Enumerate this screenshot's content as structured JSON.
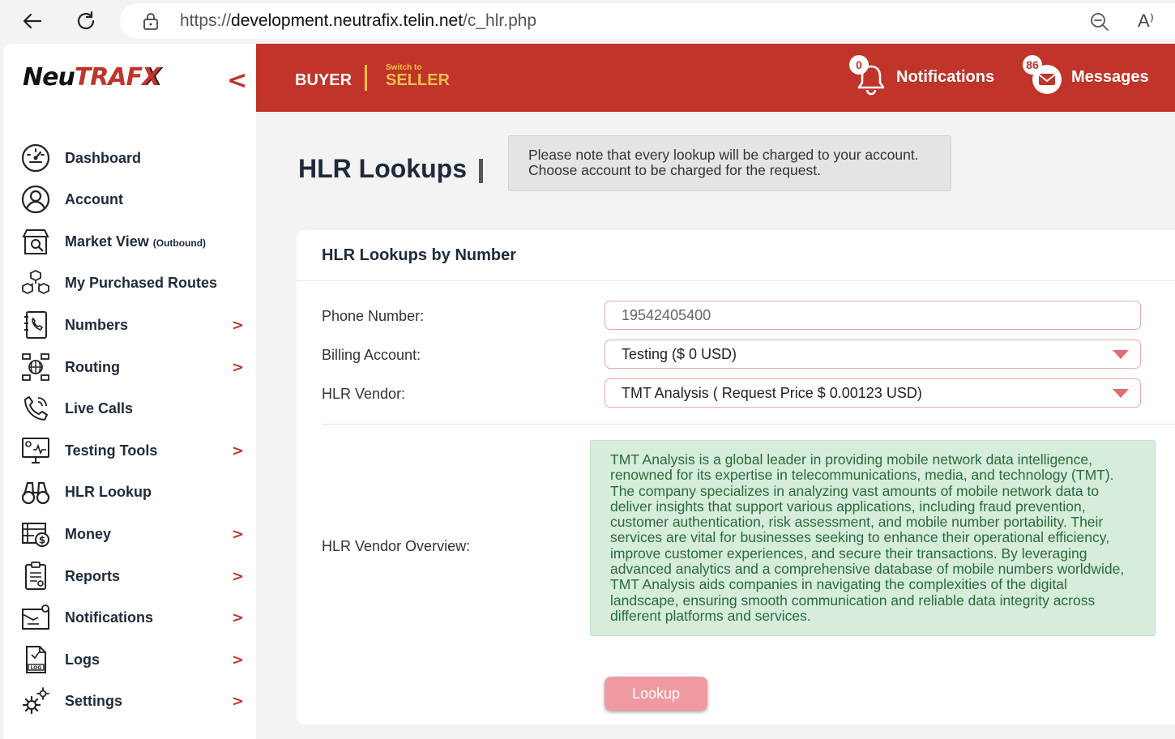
{
  "browser": {
    "url_prefix": "https://",
    "url_domain": "development.neutrafix.telin.net",
    "url_path": "/c_hlr.php",
    "read_aloud_label": "A⁾"
  },
  "sidebar": {
    "logo_part1": "Neu",
    "logo_part2": "TRAF",
    "logo_part3": "X",
    "collapse_label": "<",
    "items": [
      {
        "label": "Dashboard",
        "arrow": ""
      },
      {
        "label": "Account",
        "arrow": ""
      },
      {
        "label": "Market View",
        "sub": "(Outbound)",
        "arrow": ""
      },
      {
        "label": "My Purchased Routes",
        "arrow": ""
      },
      {
        "label": "Numbers",
        "arrow": ">"
      },
      {
        "label": "Routing",
        "arrow": ">"
      },
      {
        "label": "Live Calls",
        "arrow": ""
      },
      {
        "label": "Testing Tools",
        "arrow": ">"
      },
      {
        "label": "HLR Lookup",
        "arrow": ""
      },
      {
        "label": "Money",
        "arrow": ">"
      },
      {
        "label": "Reports",
        "arrow": ">"
      },
      {
        "label": "Notifications",
        "arrow": ">"
      },
      {
        "label": "Logs",
        "arrow": ">"
      },
      {
        "label": "Settings",
        "arrow": ">"
      }
    ]
  },
  "header": {
    "buyer": "BUYER",
    "switch_to": "Switch to",
    "seller": "SELLER",
    "notifications_label": "Notifications",
    "notifications_count": "0",
    "messages_label": "Messages",
    "messages_count": "86",
    "accent_color": "#c0342a",
    "gold_color": "#f0c14a"
  },
  "page": {
    "title": "HLR Lookups",
    "note_line1": "Please note that every lookup will be charged to your account.",
    "note_line2": "Choose account to be charged for the request."
  },
  "card": {
    "title": "HLR Lookups by Number",
    "phone_label": "Phone Number:",
    "phone_placeholder": "19542405400",
    "billing_label": "Billing Account:",
    "billing_value": "Testing ($ 0 USD)",
    "vendor_label": "HLR Vendor:",
    "vendor_value": "TMT Analysis ( Request Price $ 0.00123 USD)",
    "overview_label": "HLR Vendor Overview:",
    "overview_text": "TMT Analysis is a global leader in providing mobile network data intelligence, renowned for its expertise in telecommunications, media, and technology (TMT). The company specializes in analyzing vast amounts of mobile network data to deliver insights that support various applications, including fraud prevention, customer authentication, risk assessment, and mobile number portability. Their services are vital for businesses seeking to enhance their operational efficiency, improve customer experiences, and secure their transactions. By leveraging advanced analytics and a comprehensive database of mobile numbers worldwide, TMT Analysis aids companies in navigating the complexities of the digital landscape, ensuring smooth communication and reliable data integrity across different platforms and services.",
    "lookup_button": "Lookup"
  }
}
